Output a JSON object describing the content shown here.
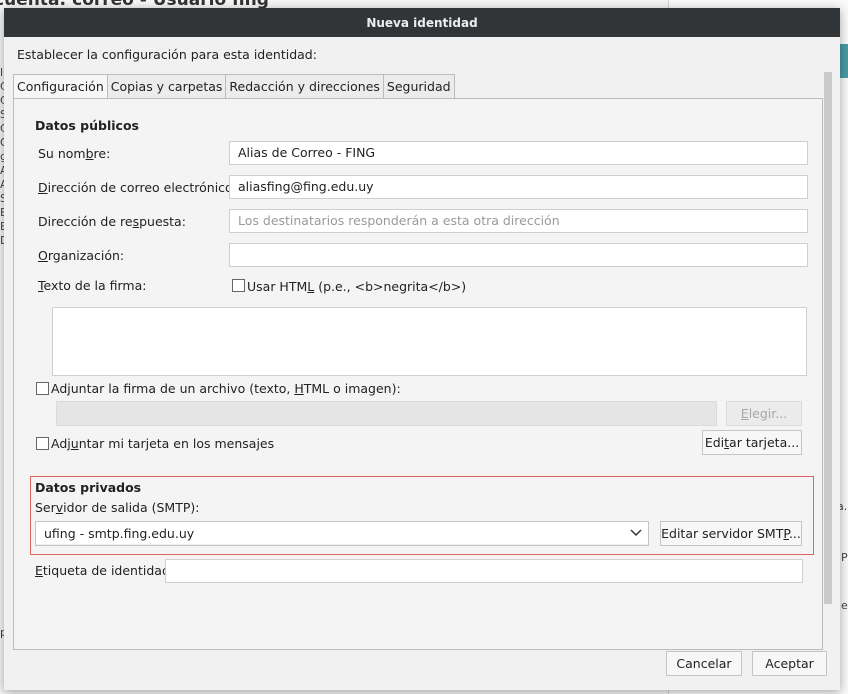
{
  "background": {
    "title_fragment": "cuenta: correo - Usuario fing",
    "left_letters": [
      "l",
      "C",
      "C",
      "S",
      "C",
      "O",
      "g",
      "A",
      "A",
      "S",
      "E",
      "E",
      "D"
    ],
    "right_fragments": [
      "a.",
      "P",
      "e"
    ],
    "bottom_letter": "p"
  },
  "dialog": {
    "title": "Nueva identidad",
    "intro": "Establecer la configuración para esta identidad:",
    "tabs": [
      {
        "label": "Configuración",
        "active": true
      },
      {
        "label": "Copias y carpetas",
        "active": false
      },
      {
        "label": "Redacción y direcciones",
        "active": false
      },
      {
        "label": "Seguridad",
        "active": false
      }
    ]
  },
  "public": {
    "heading": "Datos públicos",
    "name_label_pre": "Su nom",
    "name_label_u": "b",
    "name_label_post": "re:",
    "name_value": "Alias de Correo -  FING",
    "email_label_u": "D",
    "email_label_post": "irección de correo electrónico:",
    "email_value": "aliasfing@fing.edu.uy",
    "reply_label_pre": "Dirección de re",
    "reply_label_u": "s",
    "reply_label_post": "puesta:",
    "reply_placeholder": "Los destinatarios responderán a esta otra dirección",
    "org_label_u": "O",
    "org_label_post": "rganización:",
    "org_value": "",
    "sig_label_u": "T",
    "sig_label_post": "exto de la firma:",
    "html_cb_pre": "Usar HTM",
    "html_cb_u": "L",
    "html_cb_post": " (p.e., <b>negrita</b>)",
    "html_checked": false,
    "attach_sig_pre": "Adjuntar la firma de un archivo (texto, ",
    "attach_sig_u": "H",
    "attach_sig_post": "TML o imagen):",
    "attach_sig_checked": false,
    "choose_button_u": "E",
    "choose_button_post": "legir...",
    "vcard_pre": "Adj",
    "vcard_u": "u",
    "vcard_post": "ntar mi tarjeta en los mensajes",
    "vcard_checked": false,
    "edit_card_pre": "Edi",
    "edit_card_u": "t",
    "edit_card_post": "ar tarjeta..."
  },
  "private": {
    "heading": "Datos privados",
    "smtp_label_pre": "Ser",
    "smtp_label_u": "v",
    "smtp_label_post": "idor de salida (SMTP):",
    "smtp_selected": "ufing - smtp.fing.edu.uy",
    "edit_smtp_pre": "Editar servidor SMT",
    "edit_smtp_u": "P",
    "edit_smtp_post": "...",
    "identity_label_u": "E",
    "identity_label_post": "tiqueta de identidad:",
    "identity_value": ""
  },
  "footer": {
    "cancel": "Cancelar",
    "accept": "Aceptar"
  },
  "colors": {
    "titlebar": "#313538",
    "highlight_border": "#e06666",
    "teal_accent": "#4a9aa4"
  }
}
